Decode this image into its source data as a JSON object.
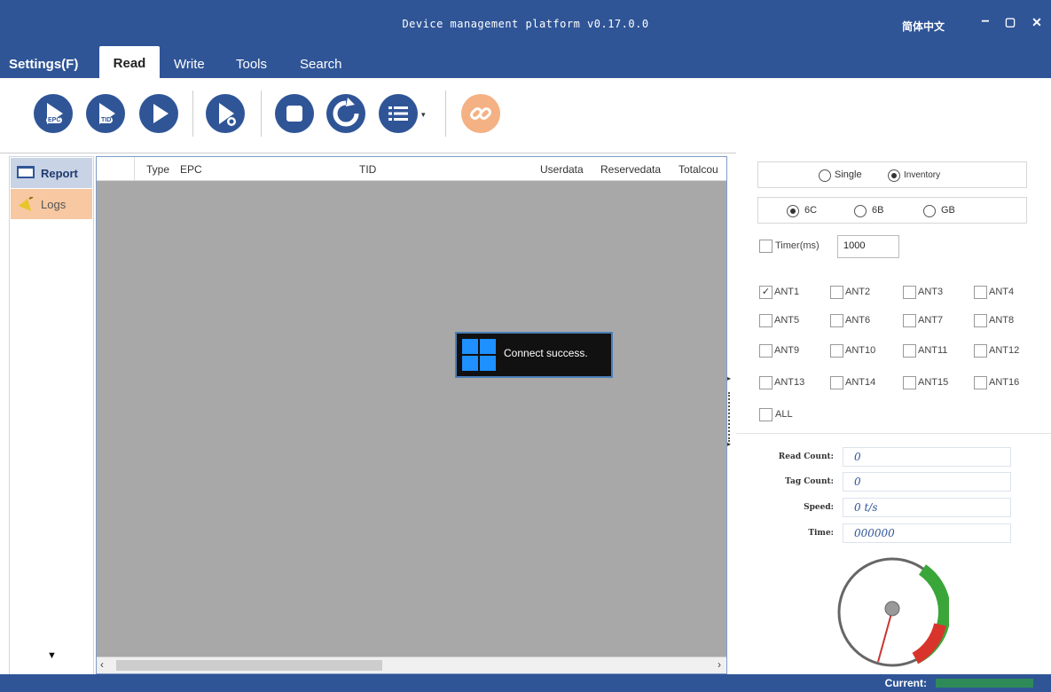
{
  "window": {
    "title": "Device management platform v0.17.0.0",
    "lang": "简体中文",
    "min": "−",
    "max": "▢",
    "close": "✕"
  },
  "menu": {
    "settings": "Settings(F)",
    "read": "Read",
    "write": "Write",
    "tools": "Tools",
    "search": "Search"
  },
  "toolbar": {
    "epc_label": "EPC",
    "tid_label": "TID"
  },
  "left_nav": {
    "report": "Report",
    "logs": "Logs",
    "more": "▼"
  },
  "grid": {
    "columns": [
      "Type",
      "EPC",
      "TID",
      "Userdata",
      "Reservedata",
      "Totalcou"
    ]
  },
  "toast": {
    "message": "Connect success."
  },
  "right": {
    "mode": {
      "single": "Single",
      "inventory": "Inventory",
      "selected": "inventory"
    },
    "protocol": {
      "c6": "6C",
      "b6": "6B",
      "gb": "GB",
      "selected": "6C"
    },
    "timer": {
      "label": "Timer(ms)",
      "value": "1000",
      "checked": false
    },
    "antennas": [
      "ANT1",
      "ANT2",
      "ANT3",
      "ANT4",
      "ANT5",
      "ANT6",
      "ANT7",
      "ANT8",
      "ANT9",
      "ANT10",
      "ANT11",
      "ANT12",
      "ANT13",
      "ANT14",
      "ANT15",
      "ANT16"
    ],
    "antenna_checked": [
      "ANT1"
    ],
    "all": "ALL",
    "stats": {
      "read_count_label": "Read Count:",
      "read_count": "0",
      "tag_count_label": "Tag Count:",
      "tag_count": "0",
      "speed_label": "Speed:",
      "speed": "0 t/s",
      "time_label": "Time:",
      "time": "000000"
    }
  },
  "status": {
    "label": "Current:"
  },
  "colors": {
    "primary": "#2f5597",
    "gauge_green": "#3aa63a",
    "gauge_red": "#d9342b"
  }
}
